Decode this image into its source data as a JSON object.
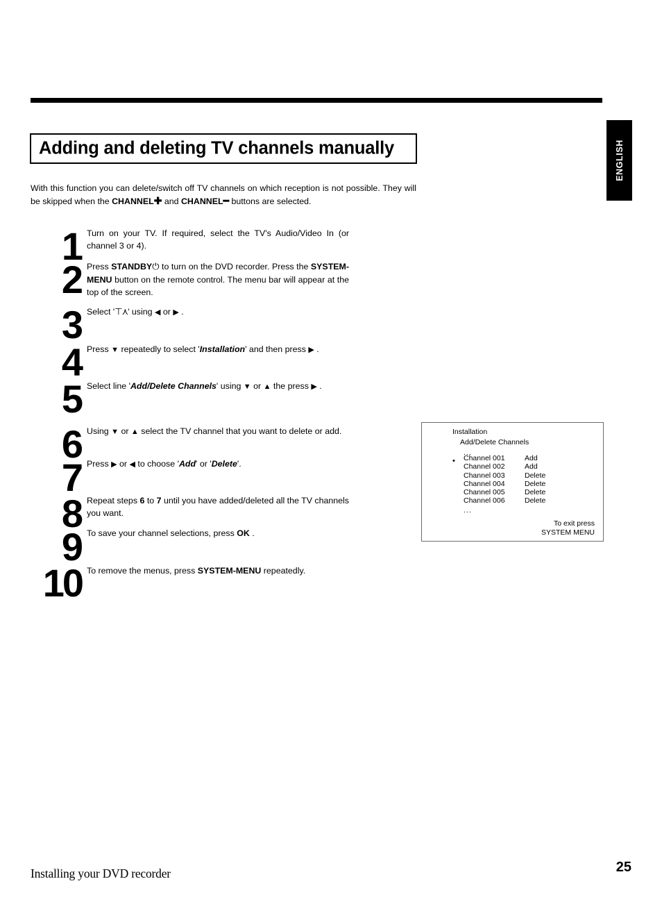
{
  "page": {
    "language_tab": "ENGLISH",
    "title": "Adding and deleting TV channels manually",
    "intro_prefix": "With this function you can delete/switch off TV channels on which reception is not possible. They will be skipped when the ",
    "intro_channel_plus": "CHANNEL",
    "intro_plus_symbol": "✚",
    "intro_mid": " and ",
    "intro_channel_minus": "CHANNEL",
    "intro_minus_symbol": "━",
    "intro_suffix": " buttons are selected."
  },
  "steps": [
    {
      "number": "1",
      "text": "Turn on your TV. If required, select the TV's Audio/Video In (or channel 3 or 4)."
    },
    {
      "number": "2",
      "part1": "Press ",
      "bold1": "STANDBY",
      "power_symbol": "⏻",
      "part2": " to turn on the DVD recorder. Press the ",
      "bold2": "SYSTEM-MENU",
      "part3": " button on the remote control. The menu bar will appear at the top of the screen."
    },
    {
      "number": "3",
      "part1": "Select '",
      "glyph": "⊤⋏",
      "part2": "' using ",
      "arrow_left": "◀",
      "part3": " or ",
      "arrow_right": "▶",
      "part4": " ."
    },
    {
      "number": "4",
      "part1": "Press ",
      "arrow_down": "▼",
      "part2": " repeatedly to select '",
      "italic": "Installation",
      "part3": "' and then press ",
      "arrow_right": "▶",
      "part4": " ."
    },
    {
      "number": "5",
      "part1": "Select line '",
      "italic": "Add/Delete Channels",
      "part2": "' using ",
      "arrow_down": "▼",
      "part3": " or ",
      "arrow_up": "▲",
      "part4": " the press ",
      "arrow_right": "▶",
      "part5": " ."
    },
    {
      "number": "6",
      "part1": "Using ",
      "arrow_down": "▼",
      "part2": " or ",
      "arrow_up": "▲",
      "part3": " select the TV channel that you want to delete or add."
    },
    {
      "number": "7",
      "part1": "Press ",
      "arrow_right": "▶",
      "part2": " or ",
      "arrow_left": "◀",
      "part3": " to choose '",
      "italic1": "Add",
      "part4": "' or '",
      "italic2": "Delete",
      "part5": "'."
    },
    {
      "number": "8",
      "part1": "Repeat steps ",
      "bold1": "6",
      "part2": " to ",
      "bold2": "7",
      "part3": " until you have added/deleted all the TV channels you want."
    },
    {
      "number": "9",
      "part1": "To save your channel selections, press ",
      "bold1": "OK",
      "part2": " ."
    },
    {
      "number": "10",
      "part1": "To remove the menus, press ",
      "bold1": "SYSTEM-MENU",
      "part2": " repeatedly."
    }
  ],
  "tv_screen": {
    "title": "Installation",
    "subtitle": "Add/Delete Channels",
    "ellipsis_top": "...",
    "ellipsis_bottom": "...",
    "bullet": "•",
    "rows": [
      {
        "channel": "Channel 001",
        "action": "Add"
      },
      {
        "channel": "Channel 002",
        "action": "Add"
      },
      {
        "channel": "Channel 003",
        "action": "Delete"
      },
      {
        "channel": "Channel 004",
        "action": "Delete"
      },
      {
        "channel": "Channel 005",
        "action": "Delete"
      },
      {
        "channel": "Channel 006",
        "action": "Delete"
      }
    ],
    "exit_line1": "To exit press",
    "exit_line2": "SYSTEM MENU"
  },
  "footer": {
    "section": "Installing your DVD recorder",
    "page_number": "25"
  }
}
